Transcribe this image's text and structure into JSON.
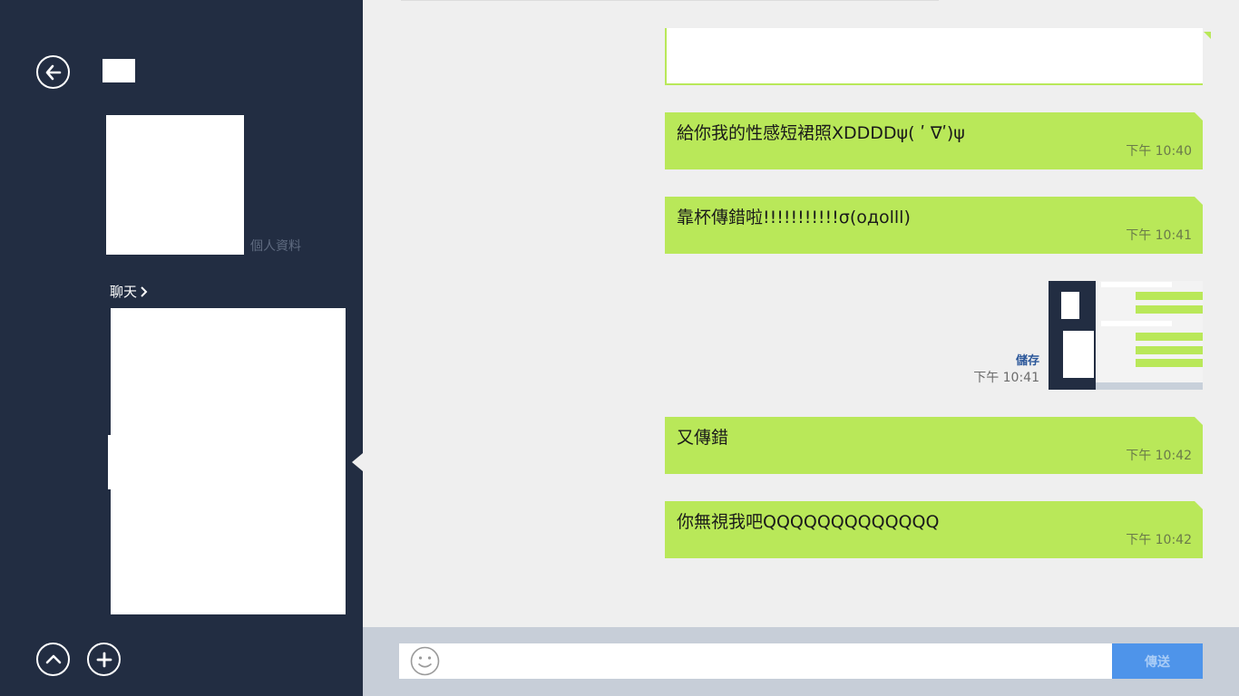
{
  "sidebar": {
    "profile_label": "個人資料",
    "chat_link": "聊天"
  },
  "messages": [
    {
      "text": "",
      "time": ""
    },
    {
      "text": "給你我的性感短裙照XDDDDψ( ʹ ∇ʹ)ψ",
      "time": "下午 10:40"
    },
    {
      "text": "靠杯傳錯啦!!!!!!!!!!!σ(oдolll)",
      "time": "下午 10:41"
    },
    {
      "text": "又傳錯",
      "time": "下午 10:42"
    },
    {
      "text": "你無視我吧QQQQQQQQQQQQQ",
      "time": "下午 10:42"
    }
  ],
  "image_message": {
    "save_label": "儲存",
    "time": "下午 10:41"
  },
  "composer": {
    "send_label": "傳送",
    "placeholder": ""
  },
  "colors": {
    "sidebar_bg": "#222d42",
    "bubble_green": "#b9e859",
    "send_blue": "#4e94ea",
    "chat_bg": "#efefef"
  },
  "icons": [
    "back-arrow-icon",
    "chevron-right-icon",
    "scroll-up-icon",
    "add-icon",
    "smiley-icon"
  ]
}
